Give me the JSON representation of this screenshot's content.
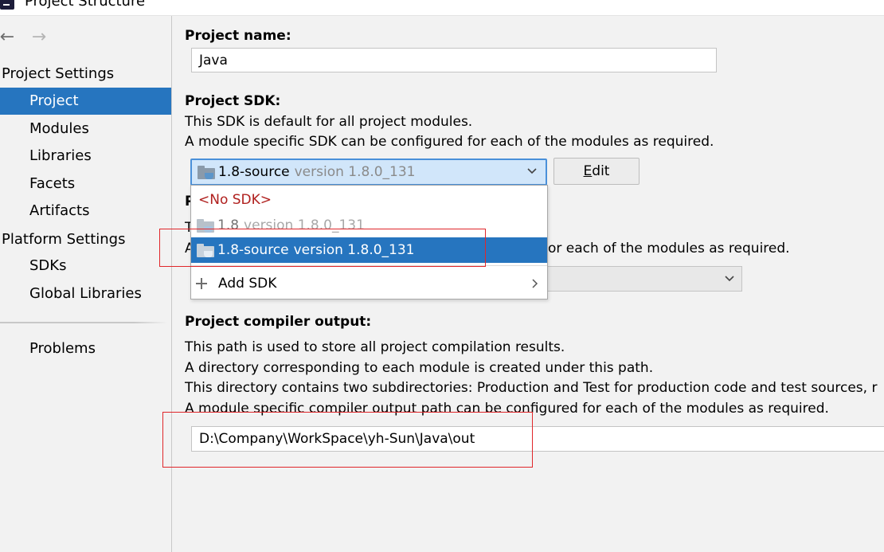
{
  "window": {
    "title": "Project Structure"
  },
  "nav": {
    "back_icon": "arrow-left-icon",
    "forward_icon": "arrow-right-icon"
  },
  "sidebar": {
    "project_settings_header": "Project Settings",
    "project_settings_items": [
      {
        "label": "Project",
        "selected": true
      },
      {
        "label": "Modules"
      },
      {
        "label": "Libraries"
      },
      {
        "label": "Facets"
      },
      {
        "label": "Artifacts"
      }
    ],
    "platform_settings_header": "Platform Settings",
    "platform_settings_items": [
      {
        "label": "SDKs"
      },
      {
        "label": "Global Libraries"
      }
    ],
    "problems_label": "Problems"
  },
  "main": {
    "project_name_label": "Project name:",
    "project_name_value": "Java",
    "sdk_label": "Project SDK:",
    "sdk_desc_1": "This SDK is default for all project modules.",
    "sdk_desc_2": "A module specific SDK can be configured for each of the modules as required.",
    "sdk_combo": {
      "name": "1.8-source",
      "version": "version 1.8.0_131"
    },
    "edit_button": {
      "mnemonic": "E",
      "rest": "dit"
    },
    "hidden_label_fragment": "P",
    "hidden_line_1_fragment": "T",
    "hidden_line_2_prefix": "A",
    "hidden_line_2_suffix": "or each of the modules as required.",
    "sdk_dropdown": {
      "no_sdk": "<No SDK>",
      "items": [
        {
          "name": "1.8",
          "version": "version 1.8.0_131",
          "state": "disabled"
        },
        {
          "name": "1.8-source",
          "version": "version 1.8.0_131",
          "state": "selected"
        }
      ],
      "add_sdk": "Add SDK"
    },
    "compiler_output_label": "Project compiler output:",
    "compiler_desc_1": "This path is used to store all project compilation results.",
    "compiler_desc_2": "A directory corresponding to each module is created under this path.",
    "compiler_desc_3": "This directory contains two subdirectories: Production and Test for production code and test sources, r",
    "compiler_desc_4": "A module specific compiler output path can be configured for each of the modules as required.",
    "compiler_output_value": "D:\\Company\\WorkSpace\\yh-Sun\\Java\\out"
  },
  "colors": {
    "selection": "#2675bf",
    "combo_focus": "#d1e6fa",
    "annotation": "#e0262a",
    "no_sdk_text": "#b0201e"
  }
}
